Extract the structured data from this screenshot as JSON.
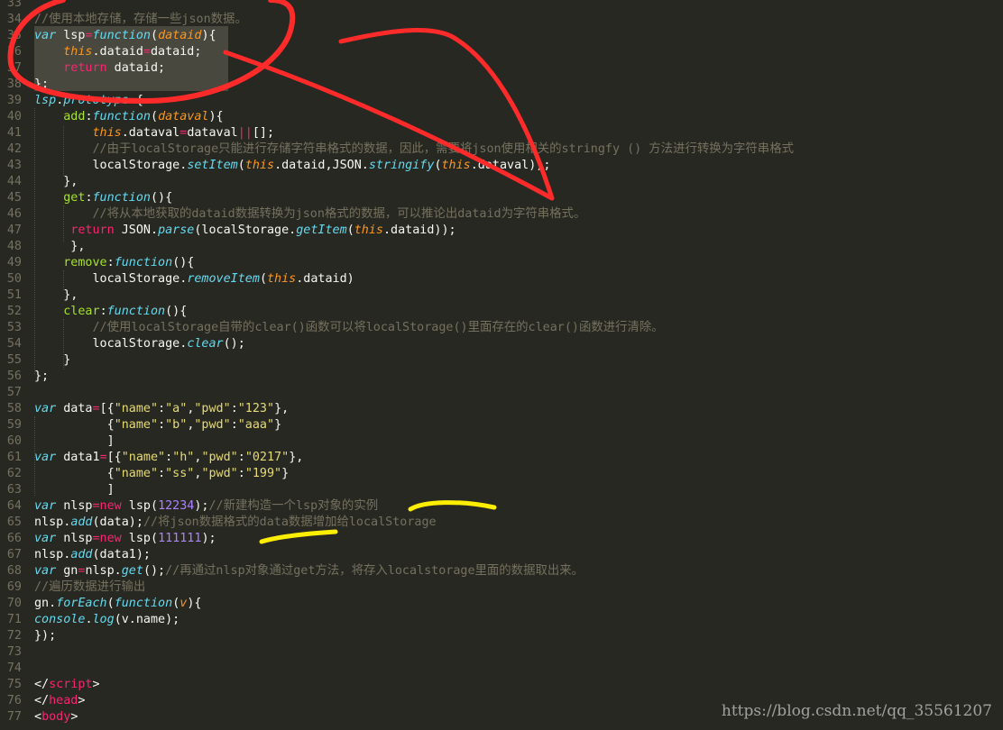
{
  "editor": {
    "theme": "monokai",
    "colors": {
      "background": "#272822",
      "keyword": "#f92672",
      "storage": "#66d9ef",
      "function": "#a6e22e",
      "parameter": "#fd971f",
      "string": "#e6db74",
      "number": "#ae81ff",
      "comment": "#75715e",
      "plain": "#f8f8f2"
    },
    "lines": [
      {
        "num": "33",
        "tokens": []
      },
      {
        "num": "34",
        "tokens": [
          [
            "c",
            "//使用本地存储，存储一些json数据。"
          ]
        ]
      },
      {
        "num": "35",
        "tokens": [
          [
            "st",
            "var"
          ],
          [
            "p",
            " lsp"
          ],
          [
            "kw",
            "="
          ],
          [
            "st",
            "function"
          ],
          [
            "p",
            "("
          ],
          [
            "pr",
            "dataid"
          ],
          [
            "p",
            "){"
          ]
        ]
      },
      {
        "num": "36",
        "tokens": [
          [
            "p",
            "    "
          ],
          [
            "pr",
            "this"
          ],
          [
            "p",
            ".dataid"
          ],
          [
            "kw",
            "="
          ],
          [
            "p",
            "dataid;"
          ]
        ]
      },
      {
        "num": "37",
        "tokens": [
          [
            "p",
            "    "
          ],
          [
            "kw",
            "return"
          ],
          [
            "p",
            " dataid;"
          ]
        ]
      },
      {
        "num": "38",
        "tokens": [
          [
            "p",
            "};"
          ]
        ]
      },
      {
        "num": "39",
        "tokens": [
          [
            "st",
            "lsp"
          ],
          [
            "p",
            "."
          ],
          [
            "st",
            "prototype"
          ],
          [
            "kw",
            "="
          ],
          [
            "p",
            "{"
          ]
        ]
      },
      {
        "num": "40",
        "tokens": [
          [
            "p",
            "    "
          ],
          [
            "fn",
            "add"
          ],
          [
            "p",
            ":"
          ],
          [
            "st",
            "function"
          ],
          [
            "p",
            "("
          ],
          [
            "pr",
            "dataval"
          ],
          [
            "p",
            "){"
          ]
        ]
      },
      {
        "num": "41",
        "tokens": [
          [
            "p",
            "        "
          ],
          [
            "pr",
            "this"
          ],
          [
            "p",
            ".dataval"
          ],
          [
            "kw",
            "="
          ],
          [
            "p",
            "dataval"
          ],
          [
            "kw",
            "||"
          ],
          [
            "p",
            "[];"
          ]
        ]
      },
      {
        "num": "42",
        "tokens": [
          [
            "p",
            "        "
          ],
          [
            "c",
            "//由于localStorage只能进行存储字符串格式的数据，因此，需要将json使用相关的stringfy () 方法进行转换为字符串格式"
          ]
        ]
      },
      {
        "num": "43",
        "tokens": [
          [
            "p",
            "        localStorage."
          ],
          [
            "st",
            "setItem"
          ],
          [
            "p",
            "("
          ],
          [
            "pr",
            "this"
          ],
          [
            "p",
            ".dataid,JSON."
          ],
          [
            "st",
            "stringify"
          ],
          [
            "p",
            "("
          ],
          [
            "pr",
            "this"
          ],
          [
            "p",
            ".dataval));"
          ]
        ]
      },
      {
        "num": "44",
        "tokens": [
          [
            "p",
            "    },"
          ]
        ]
      },
      {
        "num": "45",
        "tokens": [
          [
            "p",
            "    "
          ],
          [
            "fn",
            "get"
          ],
          [
            "p",
            ":"
          ],
          [
            "st",
            "function"
          ],
          [
            "p",
            "(){"
          ]
        ]
      },
      {
        "num": "46",
        "tokens": [
          [
            "p",
            "        "
          ],
          [
            "c",
            "//将从本地获取的dataid数据转换为json格式的数据，可以推论出dataid为字符串格式。"
          ]
        ]
      },
      {
        "num": "47",
        "tokens": [
          [
            "p",
            "     "
          ],
          [
            "kw",
            "return"
          ],
          [
            "p",
            " JSON."
          ],
          [
            "st",
            "parse"
          ],
          [
            "p",
            "(localStorage."
          ],
          [
            "st",
            "getItem"
          ],
          [
            "p",
            "("
          ],
          [
            "pr",
            "this"
          ],
          [
            "p",
            ".dataid));"
          ]
        ]
      },
      {
        "num": "48",
        "tokens": [
          [
            "p",
            "     },"
          ]
        ]
      },
      {
        "num": "49",
        "tokens": [
          [
            "p",
            "    "
          ],
          [
            "fn",
            "remove"
          ],
          [
            "p",
            ":"
          ],
          [
            "st",
            "function"
          ],
          [
            "p",
            "(){"
          ]
        ]
      },
      {
        "num": "50",
        "tokens": [
          [
            "p",
            "        localStorage."
          ],
          [
            "st",
            "removeItem"
          ],
          [
            "p",
            "("
          ],
          [
            "pr",
            "this"
          ],
          [
            "p",
            ".dataid)"
          ]
        ]
      },
      {
        "num": "51",
        "tokens": [
          [
            "p",
            "    },"
          ]
        ]
      },
      {
        "num": "52",
        "tokens": [
          [
            "p",
            "    "
          ],
          [
            "fn",
            "clear"
          ],
          [
            "p",
            ":"
          ],
          [
            "st",
            "function"
          ],
          [
            "p",
            "(){"
          ]
        ]
      },
      {
        "num": "53",
        "tokens": [
          [
            "p",
            "        "
          ],
          [
            "c",
            "//使用localStorage自带的clear()函数可以将localStorage()里面存在的clear()函数进行清除。"
          ]
        ]
      },
      {
        "num": "54",
        "tokens": [
          [
            "p",
            "        localStorage."
          ],
          [
            "st",
            "clear"
          ],
          [
            "p",
            "();"
          ]
        ]
      },
      {
        "num": "55",
        "tokens": [
          [
            "p",
            "    }"
          ]
        ]
      },
      {
        "num": "56",
        "tokens": [
          [
            "p",
            "};"
          ]
        ]
      },
      {
        "num": "57",
        "tokens": []
      },
      {
        "num": "58",
        "tokens": [
          [
            "st",
            "var"
          ],
          [
            "p",
            " data"
          ],
          [
            "kw",
            "="
          ],
          [
            "p",
            "[{"
          ],
          [
            "s",
            "\"name\""
          ],
          [
            "p",
            ":"
          ],
          [
            "s",
            "\"a\""
          ],
          [
            "p",
            ","
          ],
          [
            "s",
            "\"pwd\""
          ],
          [
            "p",
            ":"
          ],
          [
            "s",
            "\"123\""
          ],
          [
            "p",
            "},"
          ]
        ]
      },
      {
        "num": "59",
        "tokens": [
          [
            "p",
            "          {"
          ],
          [
            "s",
            "\"name\""
          ],
          [
            "p",
            ":"
          ],
          [
            "s",
            "\"b\""
          ],
          [
            "p",
            ","
          ],
          [
            "s",
            "\"pwd\""
          ],
          [
            "p",
            ":"
          ],
          [
            "s",
            "\"aaa\""
          ],
          [
            "p",
            "}"
          ]
        ]
      },
      {
        "num": "60",
        "tokens": [
          [
            "p",
            "          ]"
          ]
        ]
      },
      {
        "num": "61",
        "tokens": [
          [
            "st",
            "var"
          ],
          [
            "p",
            " data1"
          ],
          [
            "kw",
            "="
          ],
          [
            "p",
            "[{"
          ],
          [
            "s",
            "\"name\""
          ],
          [
            "p",
            ":"
          ],
          [
            "s",
            "\"h\""
          ],
          [
            "p",
            ","
          ],
          [
            "s",
            "\"pwd\""
          ],
          [
            "p",
            ":"
          ],
          [
            "s",
            "\"0217\""
          ],
          [
            "p",
            "},"
          ]
        ]
      },
      {
        "num": "62",
        "tokens": [
          [
            "p",
            "          {"
          ],
          [
            "s",
            "\"name\""
          ],
          [
            "p",
            ":"
          ],
          [
            "s",
            "\"ss\""
          ],
          [
            "p",
            ","
          ],
          [
            "s",
            "\"pwd\""
          ],
          [
            "p",
            ":"
          ],
          [
            "s",
            "\"199\""
          ],
          [
            "p",
            "}"
          ]
        ]
      },
      {
        "num": "63",
        "tokens": [
          [
            "p",
            "          ]"
          ]
        ]
      },
      {
        "num": "64",
        "tokens": [
          [
            "st",
            "var"
          ],
          [
            "p",
            " nlsp"
          ],
          [
            "kw",
            "=new"
          ],
          [
            "p",
            " lsp("
          ],
          [
            "n",
            "12234"
          ],
          [
            "p",
            ");"
          ],
          [
            "c",
            "//新建构造一个lsp对象的实例"
          ]
        ]
      },
      {
        "num": "65",
        "tokens": [
          [
            "p",
            "nlsp."
          ],
          [
            "st",
            "add"
          ],
          [
            "p",
            "(data);"
          ],
          [
            "c",
            "//将json数据格式的data数据增加给localStorage"
          ]
        ]
      },
      {
        "num": "66",
        "tokens": [
          [
            "st",
            "var"
          ],
          [
            "p",
            " nlsp"
          ],
          [
            "kw",
            "=new"
          ],
          [
            "p",
            " lsp("
          ],
          [
            "n",
            "111111"
          ],
          [
            "p",
            ");"
          ]
        ]
      },
      {
        "num": "67",
        "tokens": [
          [
            "p",
            "nlsp."
          ],
          [
            "st",
            "add"
          ],
          [
            "p",
            "(data1);"
          ]
        ]
      },
      {
        "num": "68",
        "tokens": [
          [
            "st",
            "var"
          ],
          [
            "p",
            " gn"
          ],
          [
            "kw",
            "="
          ],
          [
            "p",
            "nlsp."
          ],
          [
            "st",
            "get"
          ],
          [
            "p",
            "();"
          ],
          [
            "c",
            "//再通过nlsp对象通过get方法，将存入localstorage里面的数据取出来。"
          ]
        ]
      },
      {
        "num": "69",
        "tokens": [
          [
            "c",
            "//遍历数据进行输出"
          ]
        ]
      },
      {
        "num": "70",
        "tokens": [
          [
            "p",
            "gn."
          ],
          [
            "st",
            "forEach"
          ],
          [
            "p",
            "("
          ],
          [
            "st",
            "function"
          ],
          [
            "p",
            "("
          ],
          [
            "pr",
            "v"
          ],
          [
            "p",
            "){"
          ]
        ]
      },
      {
        "num": "71",
        "tokens": [
          [
            "st",
            "console"
          ],
          [
            "p",
            "."
          ],
          [
            "st",
            "log"
          ],
          [
            "p",
            "(v.name);"
          ]
        ]
      },
      {
        "num": "72",
        "tokens": [
          [
            "p",
            "});"
          ]
        ]
      },
      {
        "num": "73",
        "tokens": []
      },
      {
        "num": "74",
        "tokens": []
      },
      {
        "num": "75",
        "tokens": [
          [
            "p",
            "</"
          ],
          [
            "kw",
            "script"
          ],
          [
            "p",
            ">"
          ]
        ]
      },
      {
        "num": "76",
        "tokens": [
          [
            "p",
            "</"
          ],
          [
            "kw",
            "head"
          ],
          [
            "p",
            ">"
          ]
        ]
      },
      {
        "num": "77",
        "tokens": [
          [
            "p",
            "<"
          ],
          [
            "kw",
            "body"
          ],
          [
            "p",
            ">"
          ]
        ]
      }
    ]
  },
  "annotations": {
    "red": "#ff2b2b",
    "yellow": "#ffee00"
  },
  "watermark": "https://blog.csdn.net/qq_35561207"
}
